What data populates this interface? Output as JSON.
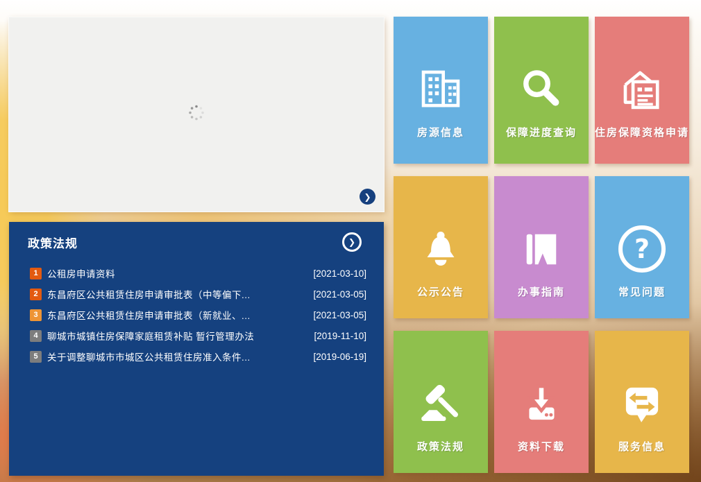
{
  "carousel": {
    "next_arrow": "❯"
  },
  "policy_panel": {
    "title": "政策法规",
    "more_arrow": "❯",
    "panel_color": "#15417f",
    "items": [
      {
        "rank": "1",
        "text": "公租房申请资料",
        "date": "[2021-03-10]",
        "badge_color": "#e35a10"
      },
      {
        "rank": "2",
        "text": "东昌府区公共租赁住房申请审批表（中等偏下...",
        "date": "[2021-03-05]",
        "badge_color": "#e35a10"
      },
      {
        "rank": "3",
        "text": "东昌府区公共租赁住房申请审批表（新就业、...",
        "date": "[2021-03-05]",
        "badge_color": "#ee9435"
      },
      {
        "rank": "4",
        "text": "聊城市城镇住房保障家庭租赁补贴 暂行管理办法",
        "date": "[2019-11-10]",
        "badge_color": "#7d7d7d"
      },
      {
        "rank": "5",
        "text": "关于调整聊城市市城区公共租赁住房准入条件...",
        "date": "[2019-06-19]",
        "badge_color": "#7d7d7d"
      }
    ]
  },
  "tiles": [
    {
      "label": "房源信息",
      "color": "#67b1e1",
      "icon": "buildings-icon"
    },
    {
      "label": "保障进度查询",
      "color": "#8fc04d",
      "icon": "search-icon"
    },
    {
      "label": "住房保障资格申请",
      "color": "#e57d7a",
      "icon": "house-document-icon"
    },
    {
      "label": "公示公告",
      "color": "#e7b64a",
      "icon": "bell-icon"
    },
    {
      "label": "办事指南",
      "color": "#c88bcf",
      "icon": "book-icon"
    },
    {
      "label": "常见问题",
      "color": "#67b1e1",
      "icon": "question-icon",
      "glyph": "?"
    },
    {
      "label": "政策法规",
      "color": "#8fc04d",
      "icon": "gavel-icon"
    },
    {
      "label": "资料下载",
      "color": "#e57d7a",
      "icon": "download-icon"
    },
    {
      "label": "服务信息",
      "color": "#e7b64a",
      "icon": "message-swap-icon"
    }
  ]
}
